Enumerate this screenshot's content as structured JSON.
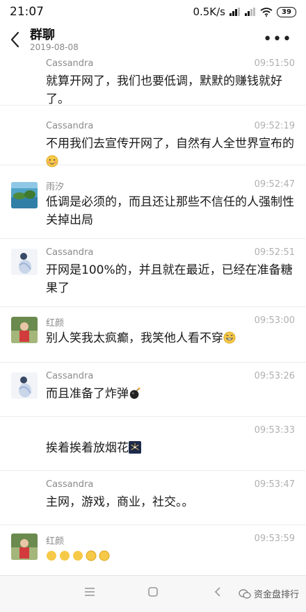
{
  "status": {
    "time": "21:07",
    "network_speed": "0.5K/s",
    "battery": "39"
  },
  "header": {
    "title": "群聊",
    "subtitle": "2019-08-08"
  },
  "messages": [
    {
      "sender": "Cassandra",
      "time": "09:51:50",
      "text": "就算开网了，我们也要低调，默默的赚钱就好了。"
    },
    {
      "sender": "Cassandra",
      "time": "09:52:19",
      "text": "不用我们去宣传开网了，自然有人全世界宣布的",
      "emoji": "blush-emoji"
    },
    {
      "sender": "雨汐",
      "time": "09:52:47",
      "text": "低调是必须的，而且还让那些不信任的人强制性关掉出局"
    },
    {
      "sender": "Cassandra",
      "time": "09:52:51",
      "text": "开网是100%的，并且就在最近，已经在准备糖果了"
    },
    {
      "sender": "红颜",
      "time": "09:53:00",
      "text": "别人笑我太疯癫，我笑他人看不穿",
      "emoji": "grin-emoji"
    },
    {
      "sender": "Cassandra",
      "time": "09:53:26",
      "text": "而且准备了炸弹",
      "emoji": "bomb-emoji"
    },
    {
      "sender": "",
      "time": "09:53:33",
      "text": "挨着挨着放烟花",
      "emoji": "fireworks-emoji"
    },
    {
      "sender": "Cassandra",
      "time": "09:53:47",
      "text": "主网，游戏，商业，社交。。"
    },
    {
      "sender": "红颜",
      "time": "09:53:59",
      "text": ""
    }
  ],
  "watermark": {
    "text": "资金盘排行"
  }
}
